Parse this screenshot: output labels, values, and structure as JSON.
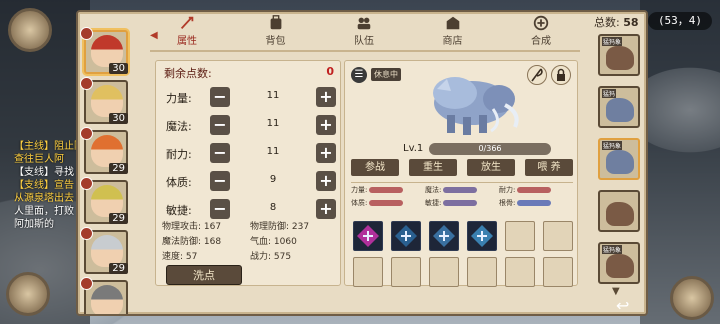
{
  "header": {
    "coords": "(53，4)",
    "total_label": "总数:",
    "total_value": "58"
  },
  "tabs": [
    {
      "label": "属性",
      "icon": "sword-icon",
      "active": true
    },
    {
      "label": "背包",
      "icon": "backpack-icon"
    },
    {
      "label": "队伍",
      "icon": "team-icon"
    },
    {
      "label": "商店",
      "icon": "shop-icon"
    },
    {
      "label": "合成",
      "icon": "compose-icon"
    }
  ],
  "heroes": [
    {
      "level": "30",
      "hair": "#c0392b",
      "selected": true
    },
    {
      "level": "30",
      "hair": "#e0c060"
    },
    {
      "level": "29",
      "hair": "#e07030"
    },
    {
      "level": "29",
      "hair": "#d0c050"
    },
    {
      "level": "29",
      "hair": "#c8ccd0"
    },
    {
      "level": "",
      "hair": "#7a7a7a"
    }
  ],
  "chat": [
    {
      "text": "【主线】阻止阿",
      "white": false
    },
    {
      "text": "查往巨人阿",
      "white": false
    },
    {
      "text": "【支线】寻找",
      "white": true
    },
    {
      "text": "【支线】宣告",
      "white": false
    },
    {
      "text": "从源泉塔出去",
      "white": false
    },
    {
      "text": "人里面，打败",
      "white": true
    },
    {
      "text": "阿加斯的",
      "white": true
    }
  ],
  "stats": {
    "remain_label": "剩余点数:",
    "remain_value": "0",
    "rows": [
      {
        "name": "力量:",
        "value": "11"
      },
      {
        "name": "魔法:",
        "value": "11"
      },
      {
        "name": "耐力:",
        "value": "11"
      },
      {
        "name": "体质:",
        "value": "9"
      },
      {
        "name": "敏捷:",
        "value": "8"
      }
    ],
    "derived": [
      [
        "物理攻击: 167",
        "物理防御: 237"
      ],
      [
        "魔法防御: 168",
        "气血: 1060"
      ],
      [
        "速度: 57",
        "战力: 575"
      ]
    ],
    "wash_label": "洗点"
  },
  "pet": {
    "state_tag": "休息中",
    "level": "Lv.1",
    "xp": "0/366",
    "xp_fraction": 0,
    "actions": [
      "参战",
      "重生",
      "放生",
      "喂 养"
    ],
    "attrs": [
      [
        "力量:",
        "魔法:",
        "耐力:"
      ],
      [
        "体质:",
        "敏捷:",
        "根骨:"
      ]
    ],
    "skill_colors": [
      "#b0309a",
      "#2a6090",
      "#3a70a0",
      "#3a80b0"
    ]
  },
  "pet_list": [
    {
      "tag": "猛犸象",
      "brown": true
    },
    {
      "tag": "猛犸",
      "brown": false
    },
    {
      "tag": "猛犸象",
      "brown": false,
      "selected": true
    },
    {
      "tag": "",
      "brown": true
    },
    {
      "tag": "猛犸象",
      "brown": true
    }
  ]
}
